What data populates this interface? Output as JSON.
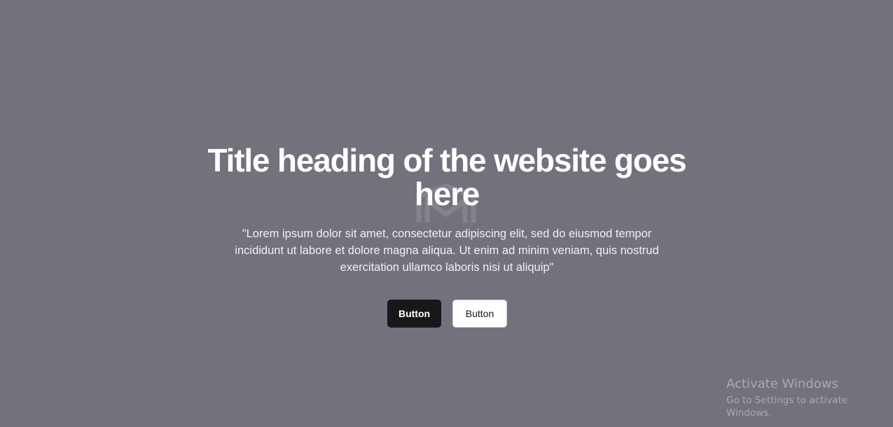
{
  "hero": {
    "title": "Title heading of the website goes here",
    "subtitle": "\"Lorem ipsum dolor sit amet, consectetur adipiscing elit, sed do eiusmod tempor incididunt ut labore et dolore magna aliqua. Ut enim ad minim veniam, quis nostrud exercitation ullamco laboris nisi ut aliquip\"",
    "primary_button": "Button",
    "secondary_button": "Button",
    "watermark_icon": "logo-watermark-icon"
  },
  "os_watermark": {
    "title": "Activate Windows",
    "subtitle": "Go to Settings to activate Windows."
  },
  "colors": {
    "background": "#71727b",
    "primary_button": "#17171a",
    "secondary_button": "#ffffff",
    "text": "#ffffff"
  }
}
